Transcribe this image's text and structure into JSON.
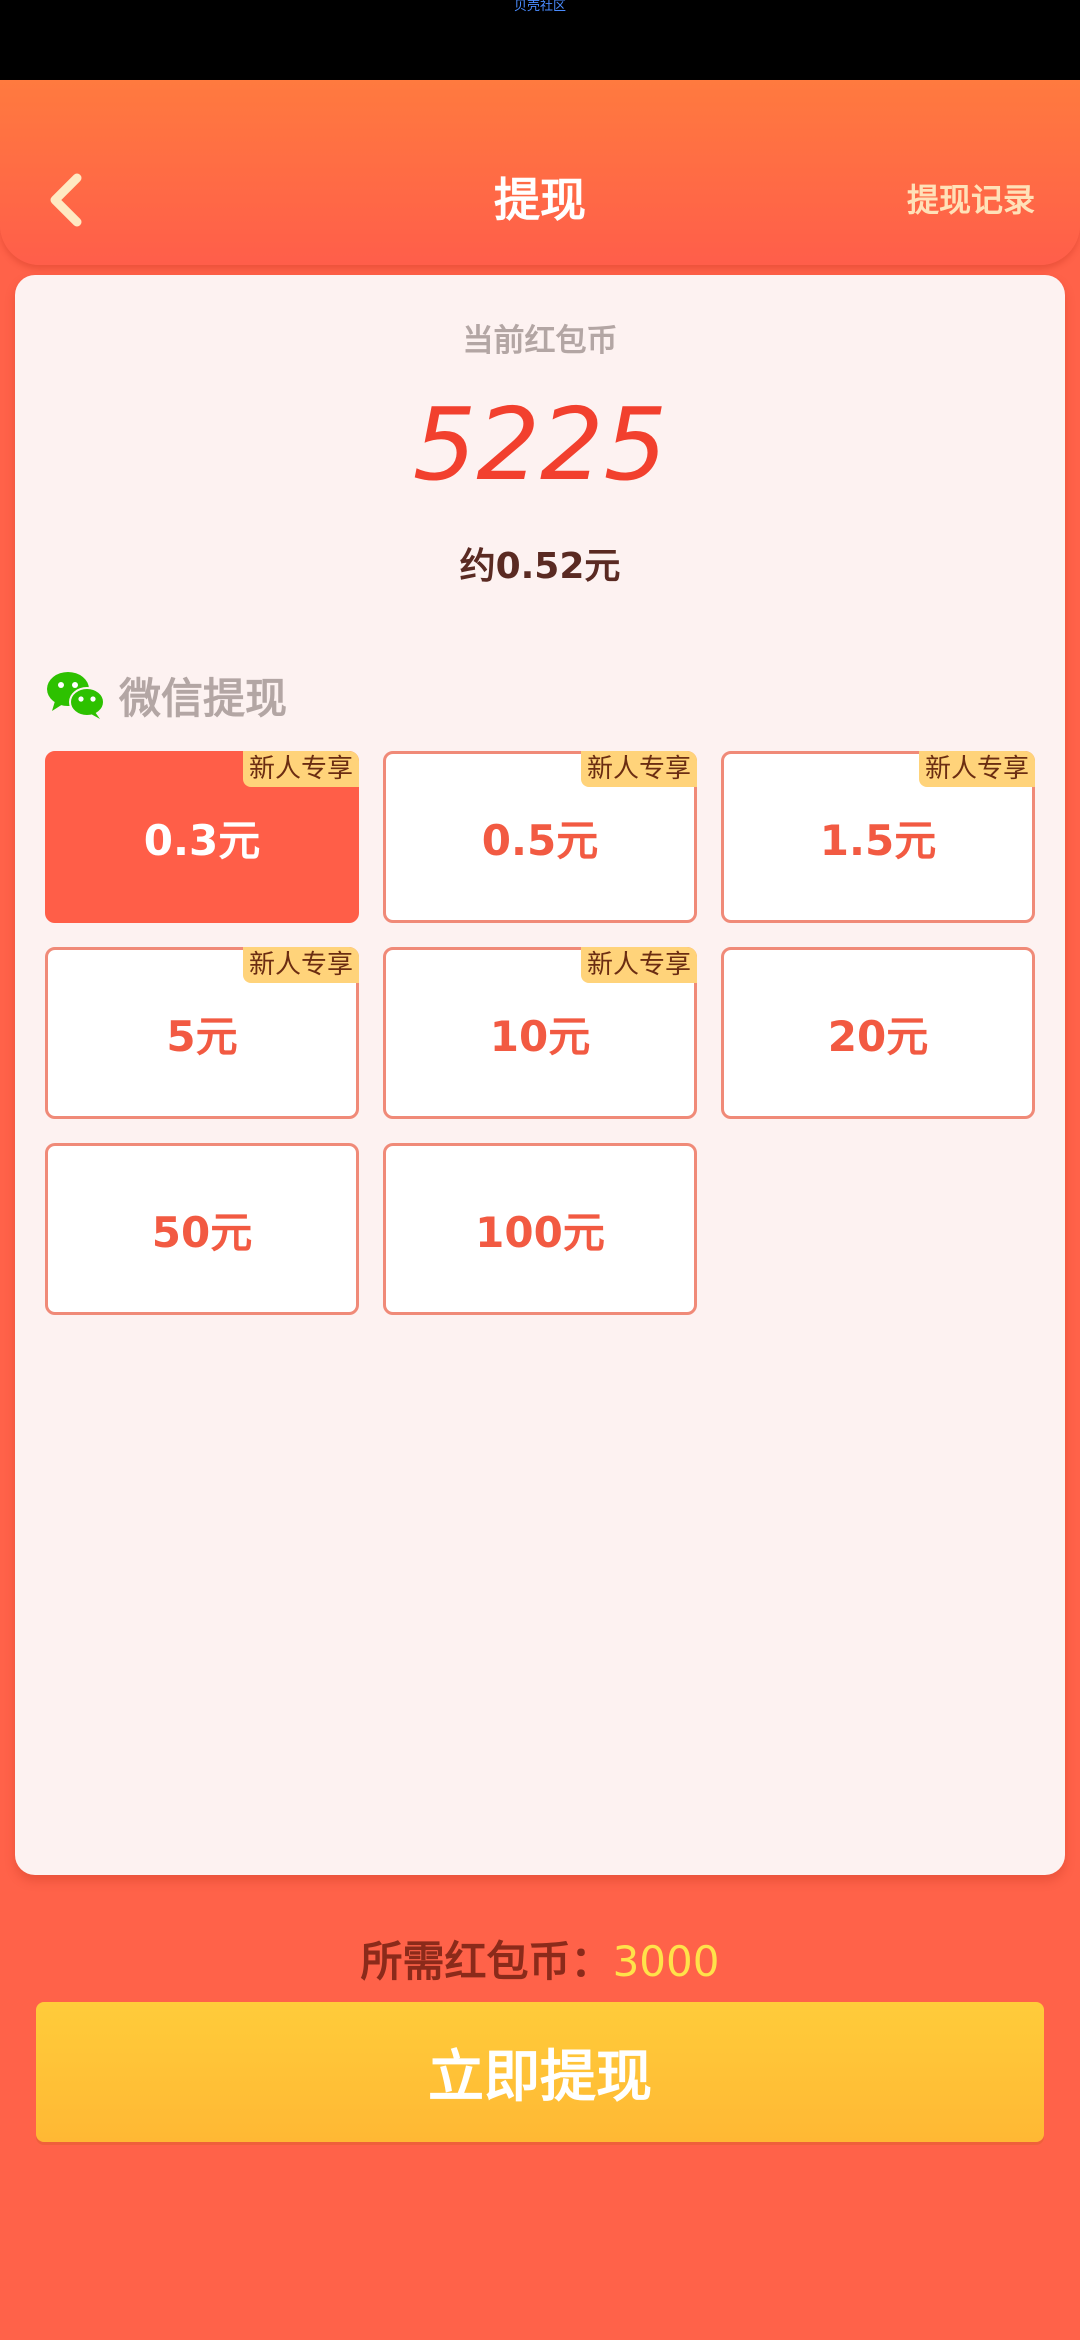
{
  "status_bar": {
    "watermark": "贝壳社区"
  },
  "header": {
    "title": "提现",
    "history_label": "提现记录"
  },
  "balance": {
    "label": "当前红包币",
    "value": "5225",
    "approx": "约0.52元"
  },
  "method": {
    "label": "微信提现",
    "icon": "wechat-icon"
  },
  "options": [
    {
      "amount": "0.3元",
      "tag": "新人专享",
      "selected": true
    },
    {
      "amount": "0.5元",
      "tag": "新人专享",
      "selected": false
    },
    {
      "amount": "1.5元",
      "tag": "新人专享",
      "selected": false
    },
    {
      "amount": "5元",
      "tag": "新人专享",
      "selected": false
    },
    {
      "amount": "10元",
      "tag": "新人专享",
      "selected": false
    },
    {
      "amount": "20元",
      "tag": "",
      "selected": false
    },
    {
      "amount": "50元",
      "tag": "",
      "selected": false
    },
    {
      "amount": "100元",
      "tag": "",
      "selected": false
    }
  ],
  "required": {
    "label": "所需红包币：",
    "value": "3000"
  },
  "withdraw_button": "立即提现",
  "colors": {
    "accent": "#ff5e48",
    "balance": "#f2402e",
    "button": "#ffc136",
    "tag": "#ffd37a"
  }
}
